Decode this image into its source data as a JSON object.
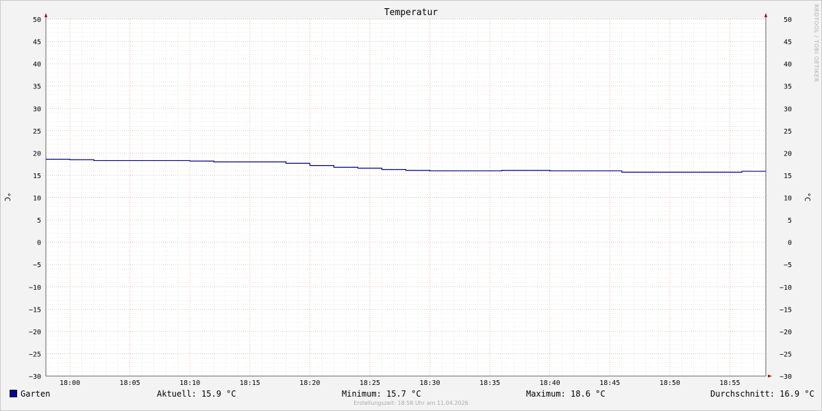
{
  "chart_data": {
    "type": "line",
    "title": "Temperatur",
    "ylabel": "°C",
    "y2label": "°C",
    "ylim": [
      -30,
      50
    ],
    "y_ticks": [
      50,
      45,
      40,
      35,
      30,
      25,
      20,
      15,
      10,
      5,
      0,
      -5,
      -10,
      -15,
      -20,
      -25,
      -30
    ],
    "x_range": [
      "17:58",
      "18:58"
    ],
    "x_ticks": [
      "18:00",
      "18:05",
      "18:10",
      "18:15",
      "18:20",
      "18:25",
      "18:30",
      "18:35",
      "18:40",
      "18:45",
      "18:50",
      "18:55"
    ],
    "grid": true,
    "series": [
      {
        "name": "Garten",
        "color": "#000080",
        "step": true,
        "points": [
          {
            "t": "17:58",
            "v": 18.6
          },
          {
            "t": "18:00",
            "v": 18.5
          },
          {
            "t": "18:02",
            "v": 18.3
          },
          {
            "t": "18:10",
            "v": 18.2
          },
          {
            "t": "18:12",
            "v": 18.0
          },
          {
            "t": "18:18",
            "v": 17.7
          },
          {
            "t": "18:20",
            "v": 17.2
          },
          {
            "t": "18:22",
            "v": 16.8
          },
          {
            "t": "18:24",
            "v": 16.6
          },
          {
            "t": "18:26",
            "v": 16.3
          },
          {
            "t": "18:28",
            "v": 16.1
          },
          {
            "t": "18:30",
            "v": 16.0
          },
          {
            "t": "18:36",
            "v": 16.1
          },
          {
            "t": "18:40",
            "v": 16.0
          },
          {
            "t": "18:46",
            "v": 15.7
          },
          {
            "t": "18:56",
            "v": 15.9
          },
          {
            "t": "18:58",
            "v": 15.9
          }
        ]
      }
    ]
  },
  "legend": {
    "series_name": "Garten",
    "current": "Aktuell: 15.9 °C",
    "minimum": "Minimum: 15.7 °C",
    "maximum": "Maximum: 18.6 °C",
    "average": "Durchschnitt: 16.9 °C"
  },
  "footer": "Erstellungszeit: 18:58 Uhr am 11.04.2026",
  "watermark": "RRDTOOL / TOBI OETIKER"
}
